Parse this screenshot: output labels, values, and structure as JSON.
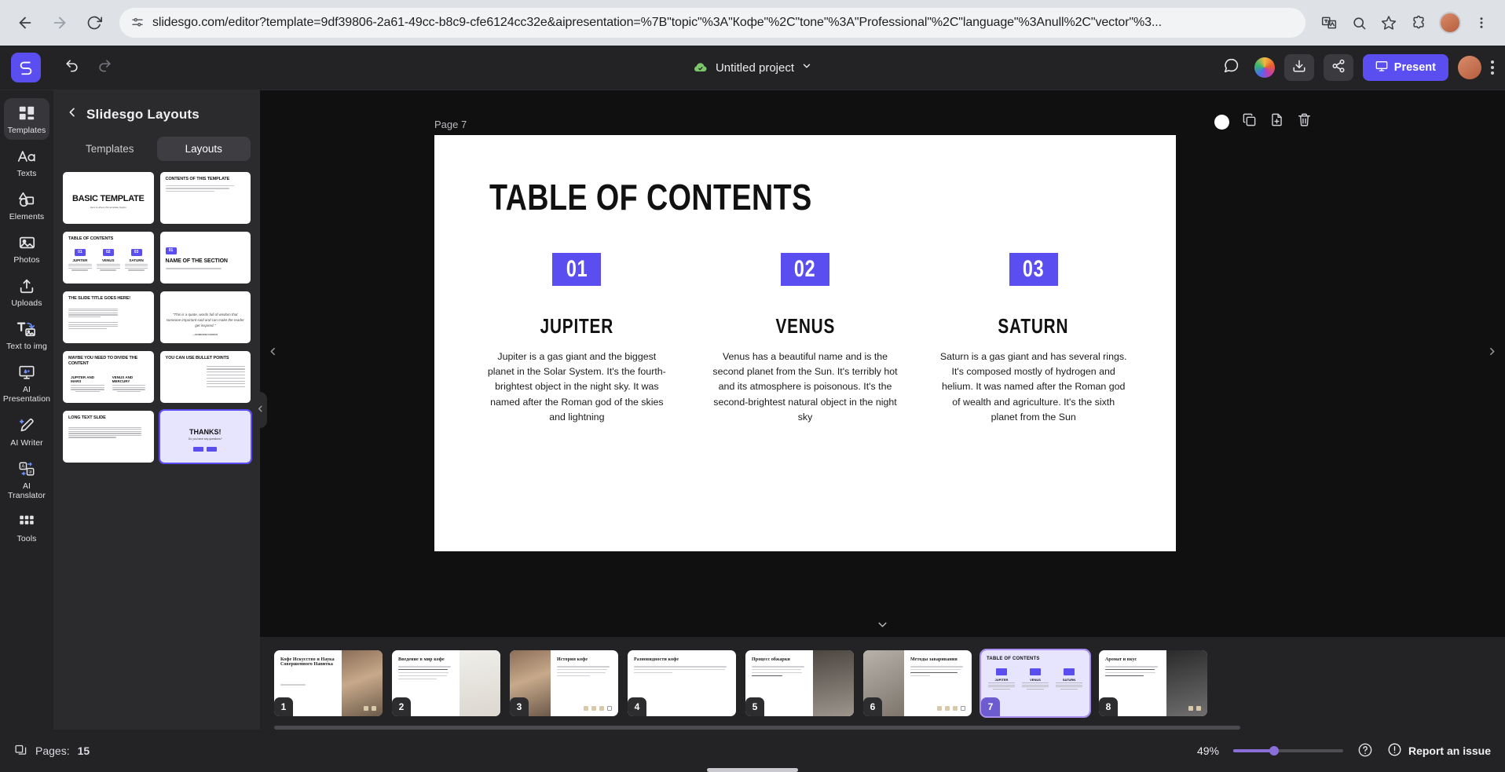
{
  "browser": {
    "url": "slidesgo.com/editor?template=9df39806-2a61-49cc-b8c9-cfe6124cc32e&aipresentation=%7B\"topic\"%3A\"Кофе\"%2C\"tone\"%3A\"Professional\"%2C\"language\"%3Anull%2C\"vector\"%3...",
    "back_icon": "back-arrow-icon",
    "forward_icon": "forward-arrow-icon",
    "reload_icon": "reload-icon",
    "site_settings_icon": "site-settings-icon",
    "translate_icon": "translate-icon",
    "search_icon": "search-icon",
    "bookmark_icon": "star-icon",
    "extensions_icon": "extensions-icon",
    "menu_icon": "kebab-menu-icon"
  },
  "app_top": {
    "logo": "slidesgo-logo",
    "undo_label": "Undo",
    "redo_label": "Redo",
    "project_title": "Untitled project",
    "saved_status_icon": "cloud-saved-icon",
    "chevron_icon": "chevron-down-icon",
    "comment_icon": "comment-icon",
    "palette_icon": "color-palette-icon",
    "download_icon": "download-icon",
    "share_icon": "share-icon",
    "present_label": "Present",
    "present_icon": "present-screen-icon",
    "avatar": "user-avatar",
    "overflow_icon": "more-options-icon",
    "accent_color": "#5b4ef0"
  },
  "rail": {
    "items": [
      {
        "label": "Templates",
        "icon": "templates-icon",
        "active": true
      },
      {
        "label": "Texts",
        "icon": "text-aa-icon",
        "active": false
      },
      {
        "label": "Elements",
        "icon": "shapes-icon",
        "active": false
      },
      {
        "label": "Photos",
        "icon": "photo-icon",
        "active": false
      },
      {
        "label": "Uploads",
        "icon": "upload-icon",
        "active": false
      },
      {
        "label": "Text to img",
        "icon": "text-to-image-icon",
        "active": false
      },
      {
        "label": "AI Presentation",
        "icon": "ai-presentation-icon",
        "active": false
      },
      {
        "label": "AI Writer",
        "icon": "magic-pencil-icon",
        "active": false
      },
      {
        "label": "AI Translator",
        "icon": "translate-ai-icon",
        "active": false
      },
      {
        "label": "Tools",
        "icon": "grid-tools-icon",
        "active": false
      }
    ]
  },
  "panel": {
    "back_icon": "chevron-left-icon",
    "title": "Slidesgo Layouts",
    "tabs": [
      {
        "label": "Templates",
        "selected": false
      },
      {
        "label": "Layouts",
        "selected": true
      }
    ],
    "layouts": [
      {
        "kind": "basic",
        "title": "BASIC TEMPLATE",
        "sub": "Here is where this template begins",
        "selected": false
      },
      {
        "kind": "contents",
        "title": "CONTENTS OF THIS TEMPLATE",
        "selected": false
      },
      {
        "kind": "toc",
        "title": "TABLE OF CONTENTS",
        "items": [
          "JUPITER",
          "VENUS",
          "SATURN"
        ],
        "badges": [
          "01",
          "02",
          "03"
        ],
        "selected": false
      },
      {
        "kind": "section",
        "title": "NAME OF THE SECTION",
        "badge": "01",
        "selected": false
      },
      {
        "kind": "text",
        "title": "THE SLIDE TITLE GOES HERE!",
        "selected": false
      },
      {
        "kind": "quote",
        "title": "\"This is a quote, words full of wisdom that someone important said and can make the reader get inspired.\"",
        "author": "—SOMEONE FAMOUS",
        "selected": false
      },
      {
        "kind": "divide",
        "title": "MAYBE YOU NEED TO DIVIDE THE CONTENT",
        "cols": [
          "JUPITER AND MARS",
          "VENUS AND MERCURY"
        ],
        "selected": false
      },
      {
        "kind": "bullets",
        "title": "YOU CAN USE BULLET POINTS",
        "selected": false
      },
      {
        "kind": "long",
        "title": "LONG TEXT SLIDE",
        "selected": false
      },
      {
        "kind": "thanks",
        "title": "THANKS!",
        "sub": "Do you have any questions?",
        "selected": true
      }
    ]
  },
  "canvas": {
    "page_label": "Page 7",
    "tools": {
      "background_dot_icon": "slide-background-color-icon",
      "duplicate_icon": "duplicate-slide-icon",
      "add_note_icon": "add-slide-icon",
      "delete_icon": "trash-icon"
    },
    "prev_arrow_icon": "chevron-left-icon",
    "next_arrow_icon": "chevron-right-icon",
    "slide": {
      "title": "TABLE OF CONTENTS",
      "badge_color": "#5b4ef0",
      "columns": [
        {
          "number": "01",
          "name": "JUPITER",
          "body": "Jupiter is a gas giant and the biggest planet in the Solar System. It's the fourth-brightest object in the night sky. It was named after the Roman god of the skies and lightning"
        },
        {
          "number": "02",
          "name": "VENUS",
          "body": "Venus has a beautiful name and is the second planet from the Sun. It's terribly hot and its atmosphere is poisonous. It's the second-brightest natural object in the night sky"
        },
        {
          "number": "03",
          "name": "SATURN",
          "body": "Saturn is a gas giant and has several rings. It's composed mostly of hydrogen and helium. It was named after the Roman god of wealth and agriculture. It's the sixth planet from the Sun"
        }
      ]
    }
  },
  "filmstrip": {
    "collapse_icon": "chevron-down-icon",
    "slides": [
      {
        "num": "1",
        "title": "Кофе Искусство и Наука Совершенного Напитка",
        "kind": "cover",
        "selected": false
      },
      {
        "num": "2",
        "title": "Введение в мир кофе",
        "kind": "text-image",
        "selected": false
      },
      {
        "num": "3",
        "title": "История кофе",
        "kind": "image-text",
        "selected": false
      },
      {
        "num": "4",
        "title": "Разновидности кофе",
        "kind": "text-only",
        "selected": false
      },
      {
        "num": "5",
        "title": "Процесс обжарки",
        "kind": "text-image",
        "selected": false
      },
      {
        "num": "6",
        "title": "Методы заваривания",
        "kind": "image-text",
        "selected": false
      },
      {
        "num": "7",
        "title": "TABLE OF CONTENTS",
        "kind": "toc",
        "selected": true
      },
      {
        "num": "8",
        "title": "Аромат и вкус",
        "kind": "text-image",
        "selected": false
      }
    ]
  },
  "bottom": {
    "pages_icon": "pages-icon",
    "pages_label": "Pages:",
    "pages_count": "15",
    "zoom_percent": "49%",
    "help_icon": "help-circle-icon",
    "report_icon": "alert-circle-icon",
    "report_label": "Report an issue"
  }
}
